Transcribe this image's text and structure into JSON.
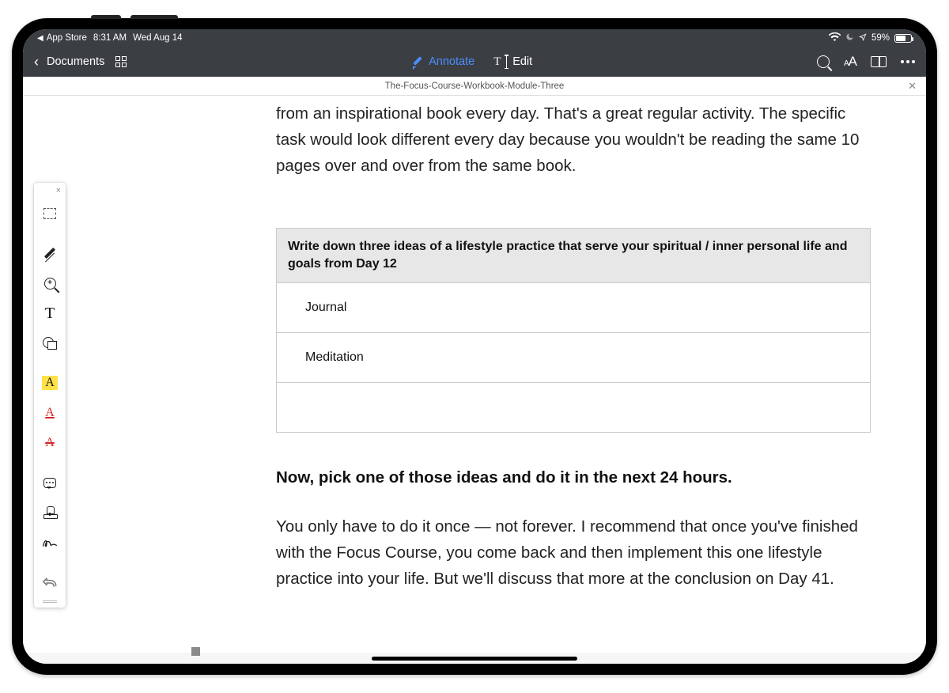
{
  "status": {
    "back_to": "App Store",
    "time": "8:31 AM",
    "date": "Wed Aug 14",
    "battery_pct": "59%"
  },
  "toolbar": {
    "back_label": "Documents",
    "annotate_label": "Annotate",
    "edit_label": "Edit"
  },
  "doc": {
    "title": "The-Focus-Course-Workbook-Module-Three"
  },
  "page_content": {
    "p1": "from an inspirational book every day. That's a great regular activity. The specific task would look different every day because you wouldn't be reading the same 10 pages over and over from the same book.",
    "prompt_header": "Write down three ideas of a lifestyle practice that serve your spiritual / inner personal life and goals from Day 12",
    "row1": "Journal",
    "row2": "Meditation",
    "row3": "",
    "h3": "Now, pick one of those ideas and do it in the next 24 hours.",
    "p2": "You only have to do it once — not forever. I recommend that once you've finished with the Focus Course, you come back and then implement this one lifestyle practice into your life. But we'll discuss that more at the conclusion on Day 41."
  },
  "tools": {
    "select": "select-tool",
    "draw": "draw-tool",
    "zoom": "zoom-tool",
    "text": "text-tool",
    "shapes": "shape-tool",
    "highlight": "highlight-tool",
    "underline": "underline-tool",
    "strike": "strikethrough-tool",
    "comment": "comment-tool",
    "stamp": "stamp-tool",
    "signature": "signature-tool",
    "undo": "undo-tool"
  }
}
